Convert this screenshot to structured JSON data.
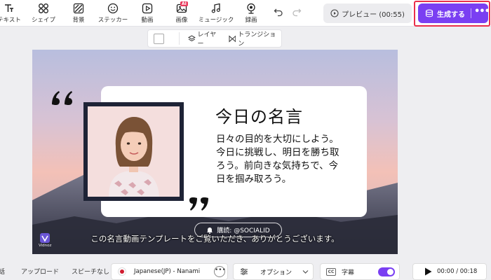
{
  "toolbar": {
    "tools": [
      {
        "label": "テキスト",
        "icon": "text-icon"
      },
      {
        "label": "シェイプ",
        "icon": "shapes-icon"
      },
      {
        "label": "背景",
        "icon": "background-icon"
      },
      {
        "label": "ステッカー",
        "icon": "sticker-icon"
      },
      {
        "label": "動画",
        "icon": "video-icon"
      },
      {
        "label": "画像",
        "icon": "image-icon",
        "badge": "AI"
      },
      {
        "label": "ミュージック",
        "icon": "music-icon"
      },
      {
        "label": "録画",
        "icon": "record-icon"
      }
    ],
    "preview_label": "プレビュー (00:55)",
    "generate_label": "生成する",
    "generate_more": "•••"
  },
  "subbar": {
    "layer_label": "レイヤー",
    "transition_label": "トランジション"
  },
  "canvas": {
    "title": "今日の名言",
    "body_lines": [
      "日々の目的を大切にしよう。",
      "今日に挑戦し、明日を勝ち取",
      "ろう。前向きな気持ちで、今",
      "日を掴み取ろう。"
    ],
    "subscribe_text": "購読: @SOCIALID",
    "caption": "この名言動画テンプレートをご覧いただき、ありがとうございます。",
    "watermark": "Vidnoz"
  },
  "bottom": {
    "tab_partial": "話",
    "upload_label": "アップロード",
    "no_speech_label": "スピーチなし",
    "voice_label": "Japanese(JP) - Nanami",
    "voice_more": "•••",
    "option_label": "オプション",
    "caption_icon": "CC",
    "caption_label": "字幕",
    "caption_toggle_on": true,
    "time_label": "00:00 / 00:18"
  },
  "colors": {
    "accent": "#7a3ff2",
    "highlight": "#ea2e4b",
    "frame": "#1e2336"
  }
}
